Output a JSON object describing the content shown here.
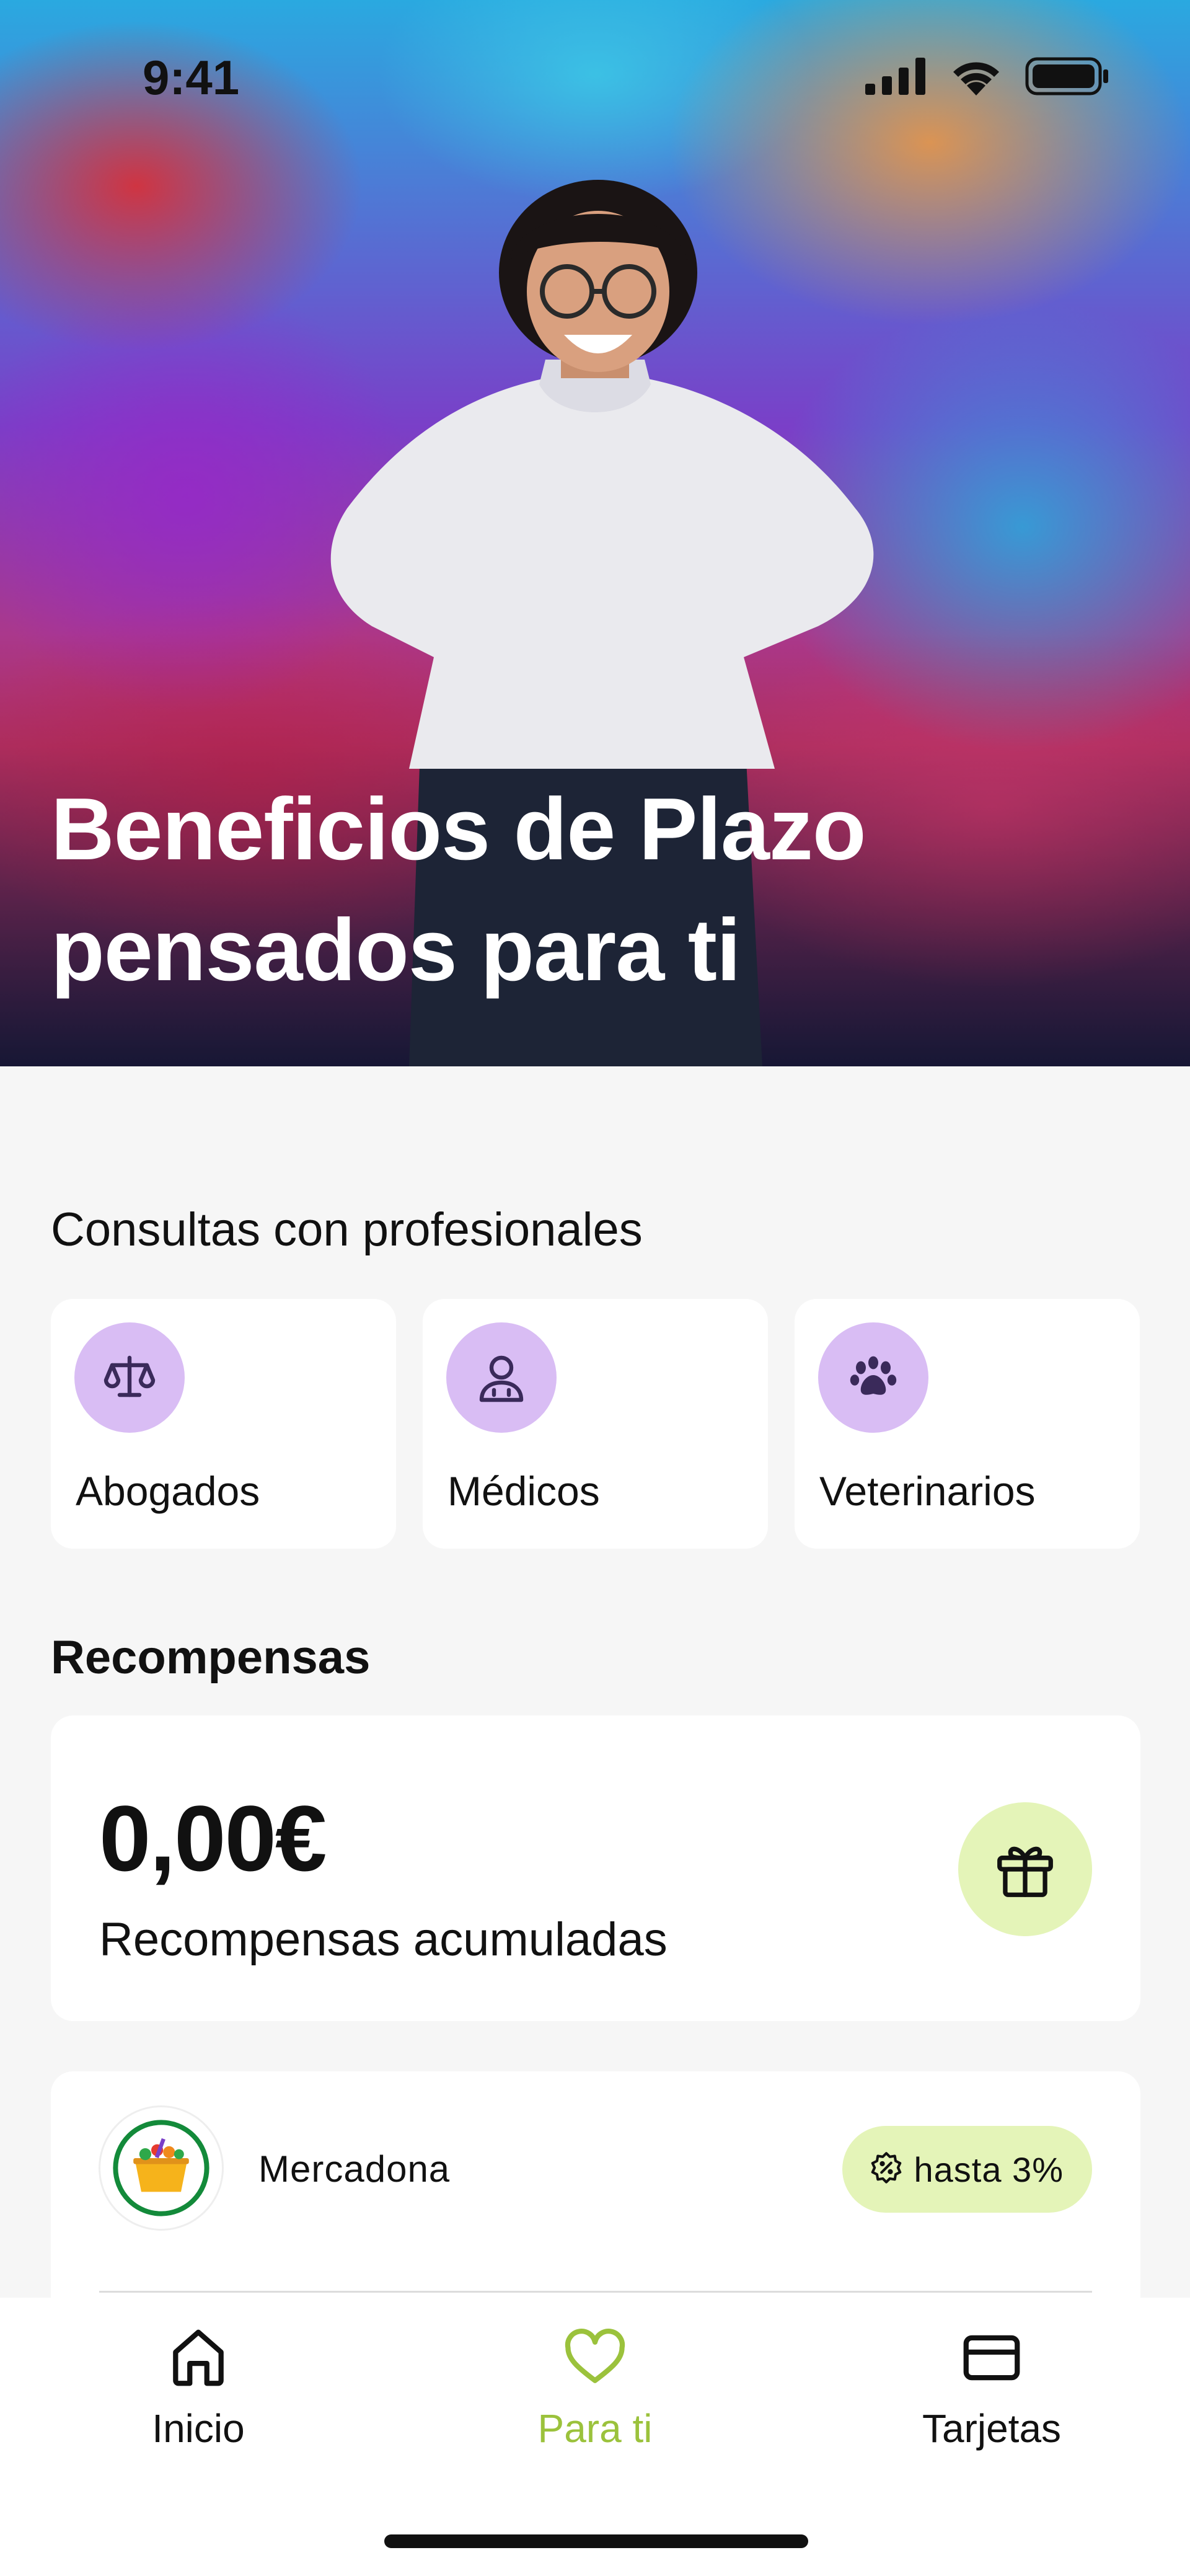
{
  "status_bar": {
    "time": "9:41"
  },
  "hero": {
    "title_line1": "Beneficios de Plazo",
    "title_line2": "pensados para ti"
  },
  "professionals": {
    "title": "Consultas con profesionales",
    "items": [
      {
        "label": "Abogados",
        "icon": "scales-icon"
      },
      {
        "label": "Médicos",
        "icon": "doctor-icon"
      },
      {
        "label": "Veterinarios",
        "icon": "paw-icon"
      }
    ]
  },
  "rewards": {
    "title": "Recompensas",
    "amount": "0,00€",
    "amount_label": "Recompensas acumuladas",
    "icon": "gift-icon"
  },
  "merchants": [
    {
      "name": "Mercadona",
      "badge": "hasta 3%",
      "badge_icon": "discount-icon"
    }
  ],
  "nav": {
    "items": [
      {
        "label": "Inicio",
        "icon": "home-icon",
        "active": false
      },
      {
        "label": "Para ti",
        "icon": "heart-icon",
        "active": true
      },
      {
        "label": "Tarjetas",
        "icon": "card-icon",
        "active": false
      }
    ]
  },
  "colors": {
    "accent_purple": "#d9bdf4",
    "accent_green": "#e4f4b8",
    "active_nav": "#9bc23c",
    "background": "#f6f6f6"
  }
}
